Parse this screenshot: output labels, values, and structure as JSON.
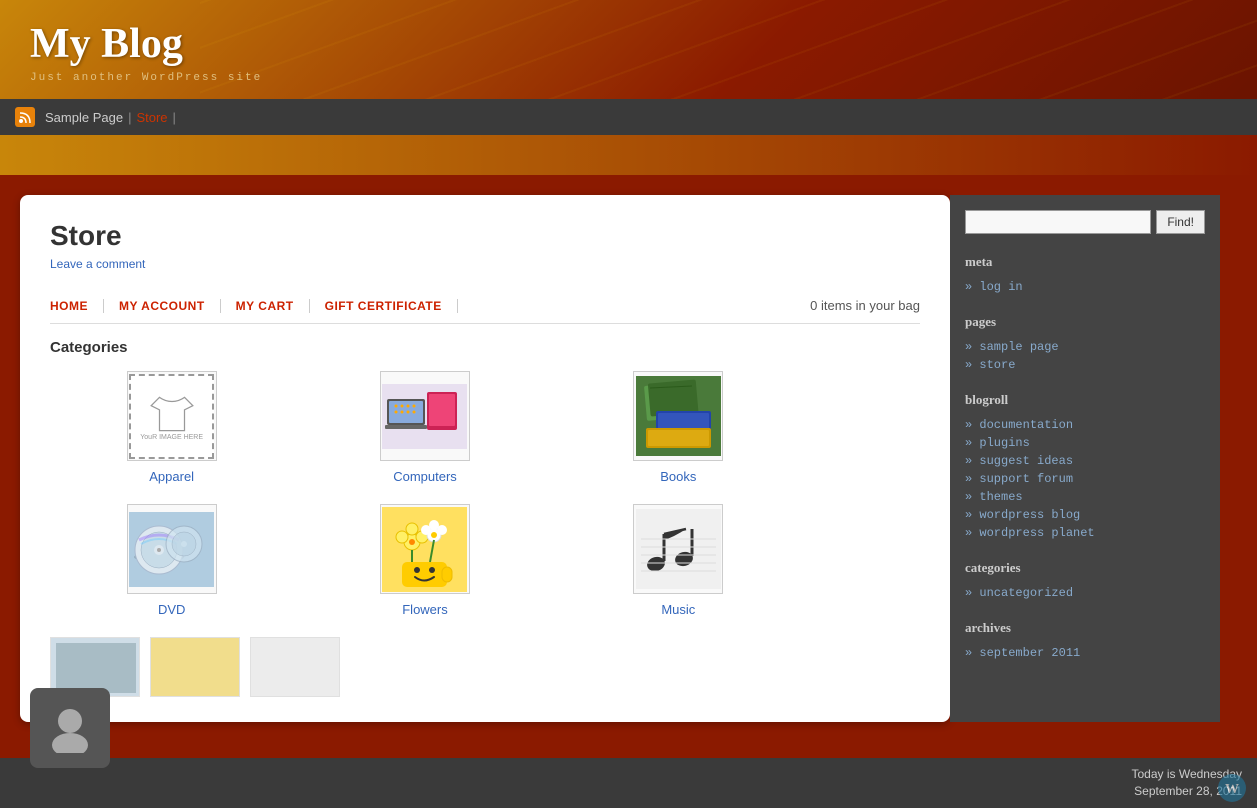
{
  "header": {
    "title": "My Blog",
    "subtitle": "Just another WordPress site"
  },
  "navbar": {
    "links": [
      {
        "label": "Sample Page",
        "active": false
      },
      {
        "label": "Store",
        "active": true
      }
    ]
  },
  "store": {
    "title": "Store",
    "leave_comment": "Leave a comment",
    "nav": [
      {
        "label": "HOME"
      },
      {
        "label": "MY ACCOUNT"
      },
      {
        "label": "MY CART"
      },
      {
        "label": "GIFT CERTIFICATE"
      }
    ],
    "cart_info": "0 items in your bag",
    "categories_title": "Categories",
    "categories": [
      {
        "label": "Apparel",
        "type": "apparel"
      },
      {
        "label": "Computers",
        "type": "computers"
      },
      {
        "label": "Books",
        "type": "books"
      },
      {
        "label": "DVD",
        "type": "dvd"
      },
      {
        "label": "Flowers",
        "type": "flowers"
      },
      {
        "label": "Music",
        "type": "music"
      }
    ]
  },
  "sidebar": {
    "search_placeholder": "",
    "search_button": "Find!",
    "meta": {
      "title": "meta",
      "links": [
        {
          "label": "log in"
        }
      ]
    },
    "pages": {
      "title": "pages",
      "links": [
        {
          "label": "sample page"
        },
        {
          "label": "store"
        }
      ]
    },
    "blogroll": {
      "title": "blogroll",
      "links": [
        {
          "label": "documentation"
        },
        {
          "label": "plugins"
        },
        {
          "label": "suggest ideas"
        },
        {
          "label": "support forum"
        },
        {
          "label": "themes"
        },
        {
          "label": "wordpress blog"
        },
        {
          "label": "wordpress planet"
        }
      ]
    },
    "categories": {
      "title": "categories",
      "links": [
        {
          "label": "uncategorized"
        }
      ]
    },
    "archives": {
      "title": "archives",
      "links": [
        {
          "label": "september 2011"
        }
      ]
    }
  },
  "bottom_bar": {
    "line1": "Today is Wednesday",
    "line2": "September 28, 2011"
  },
  "apparel_placeholder_text": "YouR IMAGE HERE"
}
